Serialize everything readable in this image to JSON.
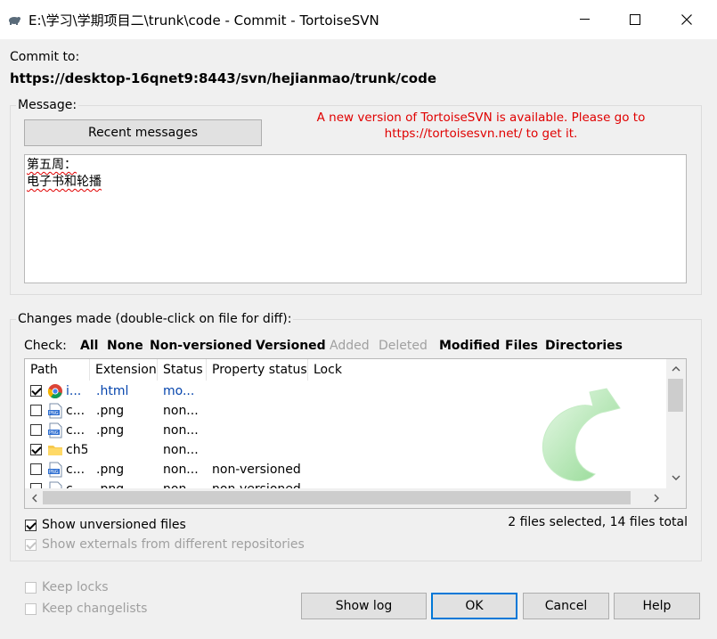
{
  "window": {
    "title": "E:\\学习\\学期项目二\\trunk\\code - Commit - TortoiseSVN",
    "app_icon": "tortoise-icon"
  },
  "commit": {
    "label": "Commit to:",
    "url": "https://desktop-16qnet9:8443/svn/hejianmao/trunk/code"
  },
  "message": {
    "group_label": "Message:",
    "recent_button": "Recent messages",
    "notice_line1": "A new version of TortoiseSVN is available. Please go to",
    "notice_line2": "https://tortoisesvn.net/ to get it.",
    "notice_color": "#e00000",
    "lines": [
      "第五周：",
      "电子书和轮播"
    ]
  },
  "changes": {
    "group_label": "Changes made (double-click on file for diff):",
    "check_label": "Check:",
    "check_options": [
      {
        "label": "All",
        "enabled": true
      },
      {
        "label": "None",
        "enabled": true
      },
      {
        "label": "Non-versioned",
        "enabled": true
      },
      {
        "label": "Versioned",
        "enabled": true
      },
      {
        "label": "Added",
        "enabled": false
      },
      {
        "label": "Deleted",
        "enabled": false
      },
      {
        "label": "Modified",
        "enabled": true
      },
      {
        "label": "Files",
        "enabled": true
      },
      {
        "label": "Directories",
        "enabled": true
      }
    ],
    "columns": [
      "Path",
      "Extension",
      "Status",
      "Property status",
      "Lock"
    ],
    "rows": [
      {
        "checked": true,
        "icon": "chrome-icon",
        "path": "i...",
        "ext": ".html",
        "status": "mo...",
        "prop": "",
        "lock": "",
        "blue": true
      },
      {
        "checked": false,
        "icon": "png-icon",
        "path": "c...",
        "ext": ".png",
        "status": "non...",
        "prop": "",
        "lock": "",
        "blue": false
      },
      {
        "checked": false,
        "icon": "png-icon",
        "path": "c...",
        "ext": ".png",
        "status": "non...",
        "prop": "",
        "lock": "",
        "blue": false
      },
      {
        "checked": true,
        "icon": "folder-icon",
        "path": "ch5",
        "ext": "",
        "status": "non...",
        "prop": "",
        "lock": "",
        "blue": false
      },
      {
        "checked": false,
        "icon": "png-icon",
        "path": "c...",
        "ext": ".png",
        "status": "non...",
        "prop": "non-versioned",
        "lock": "",
        "blue": false
      },
      {
        "checked": false,
        "icon": "png-icon",
        "path": "c...",
        "ext": ".png",
        "status": "non...",
        "prop": "non-versioned",
        "lock": "",
        "blue": false
      }
    ],
    "show_unversioned": {
      "label": "Show unversioned files",
      "checked": true
    },
    "show_externals": {
      "label": "Show externals from different repositories",
      "checked": true,
      "enabled": false
    },
    "summary": "2 files selected, 14 files total"
  },
  "options": {
    "keep_locks": {
      "label": "Keep locks",
      "checked": false,
      "enabled": false
    },
    "keep_changelists": {
      "label": "Keep changelists",
      "checked": false,
      "enabled": false
    }
  },
  "buttons": {
    "show_log": "Show log",
    "ok": "OK",
    "cancel": "Cancel",
    "help": "Help"
  },
  "colors": {
    "link_blue": "#0645ad",
    "accent": "#0078d7",
    "watermark_green": "#8fd88f"
  }
}
